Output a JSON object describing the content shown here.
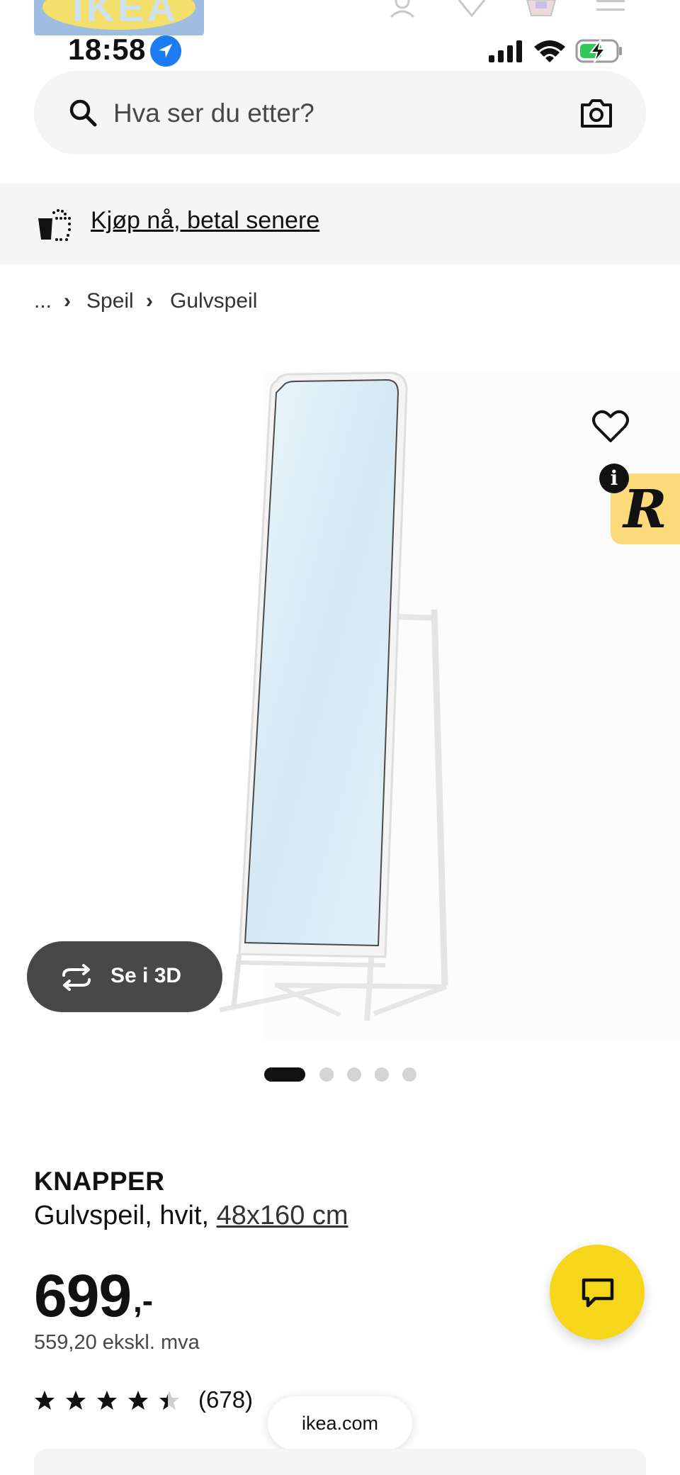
{
  "colors": {
    "accent_yellow": "#F6D61A",
    "dark_button": "#484848",
    "search_bg": "#F5F5F5",
    "location_blue": "#1E7CF2",
    "battery_green": "#34C759",
    "rating_badge": "#FCD97A"
  },
  "header": {
    "logo_text": "IKEA",
    "icons": [
      "user-icon",
      "heart-icon",
      "basket-icon",
      "menu-icon"
    ]
  },
  "status_bar": {
    "time": "18:58",
    "icons": [
      "location-arrow-icon",
      "signal-icon",
      "wifi-icon",
      "battery-charging-icon"
    ]
  },
  "search": {
    "placeholder": "Hva ser du etter?",
    "icon": "search-icon",
    "camera_icon": "camera-icon"
  },
  "banner": {
    "link_text": "Kjøp nå, betal senere",
    "icon": "dotted-basket-icon"
  },
  "breadcrumb": {
    "items": [
      "...",
      "Speil",
      "Gulvspeil"
    ],
    "separator": "›"
  },
  "media": {
    "view_3d_label": "Se i 3D",
    "carousel_count": 5,
    "carousel_active": 1,
    "favorite_icon": "heart-icon",
    "badge_letter": "R",
    "badge_info": "i"
  },
  "product": {
    "name": "KNAPPER",
    "description_prefix": "Gulvspeil, hvit, ",
    "size_link": "48x160 cm",
    "price_main": "699",
    "price_suffix": ",-",
    "price_ex_vat": "559,20 ekskl. mva",
    "rating": 4.5,
    "rating_max": 5,
    "reviews": "(678)"
  },
  "chat": {
    "icon": "chat-icon"
  },
  "browser": {
    "domain": "ikea.com"
  }
}
